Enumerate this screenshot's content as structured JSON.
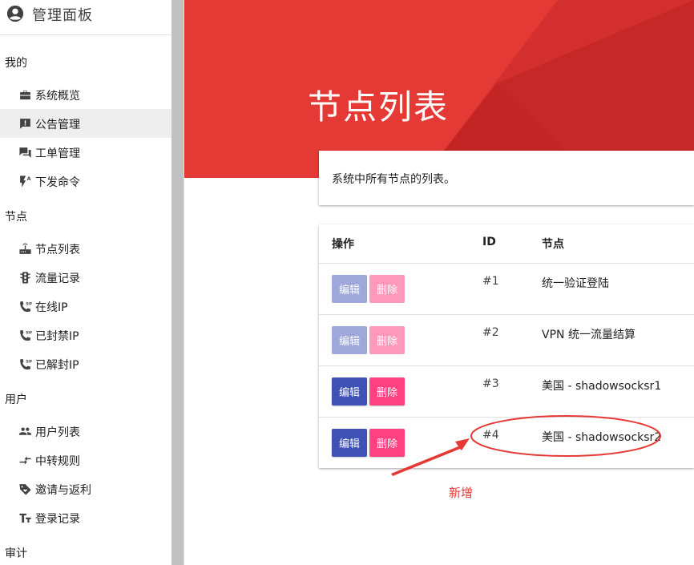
{
  "sidebar": {
    "brand": "管理面板",
    "sections": [
      {
        "label": "我的",
        "items": [
          "系统概览",
          "公告管理",
          "工单管理",
          "下发命令"
        ]
      },
      {
        "label": "节点",
        "items": [
          "节点列表",
          "流量记录",
          "在线IP",
          "已封禁IP",
          "已解封IP"
        ]
      },
      {
        "label": "用户",
        "items": [
          "用户列表",
          "中转规则",
          "邀请与返利",
          "登录记录"
        ]
      },
      {
        "label": "审计",
        "items": []
      }
    ],
    "active_item": "公告管理"
  },
  "header": {
    "title": "节点列表",
    "accent": "#e53935"
  },
  "description": "系统中所有节点的列表。",
  "table": {
    "headers": [
      "操作",
      "ID",
      "节点"
    ],
    "edit_label": "编辑",
    "delete_label": "删除",
    "rows": [
      {
        "id": "#1",
        "node": "统一验证登陆",
        "disabled": true
      },
      {
        "id": "#2",
        "node": "VPN 统一流量结算",
        "disabled": true
      },
      {
        "id": "#3",
        "node": "美国 - shadowsocksr1",
        "disabled": false
      },
      {
        "id": "#4",
        "node": "美国 - shadowsocksr2",
        "disabled": false
      }
    ]
  },
  "annotation": {
    "text": "新增",
    "color": "#e53935"
  },
  "colors": {
    "primary": "#3f51b5",
    "secondary": "#ff4081"
  }
}
